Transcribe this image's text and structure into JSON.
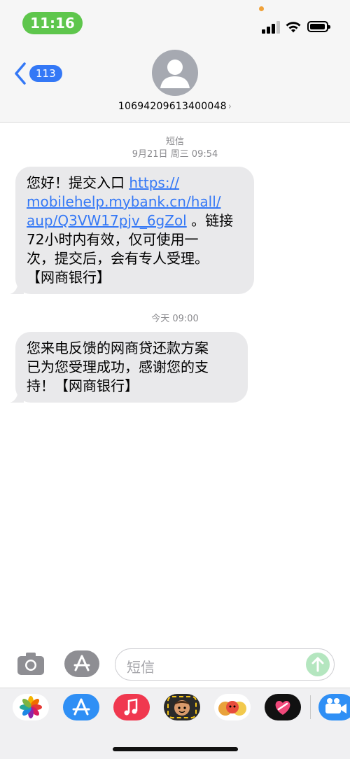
{
  "status_bar": {
    "time": "11:16"
  },
  "header": {
    "back_count": "113",
    "contact": "10694209613400048"
  },
  "conversation": {
    "first": {
      "service": "短信",
      "timestamp": "9月21日 周三 09:54",
      "message": {
        "text_before_link": "您好！提交入口 ",
        "link_line1": "https://",
        "link_line2": "mobilehelp.mybank.cn/hall/",
        "link_line3": "aup/Q3VW17pjv_6gZol",
        "text_after_link": " 。链接",
        "line4": "72小时内有效，仅可使用一",
        "line5": "次，提交后，会有专人受理。",
        "line6": "【网商银行】"
      }
    },
    "second": {
      "timestamp": "今天 09:00",
      "message": {
        "line1": "您来电反馈的网商贷还款方案",
        "line2": "已为您受理成功，感谢您的支",
        "line3": "持！【网商银行】"
      }
    }
  },
  "composer": {
    "placeholder": "短信"
  },
  "colors": {
    "accent": "#3478f6",
    "bubble": "#e9e9eb",
    "time_pill": "#5ec64c",
    "send": "#b4e6bf"
  },
  "app_drawer": [
    "photos-icon",
    "app-store-icon",
    "music-icon",
    "memoji-icon",
    "animoji-icon",
    "digital-touch-icon",
    "clips-icon"
  ]
}
